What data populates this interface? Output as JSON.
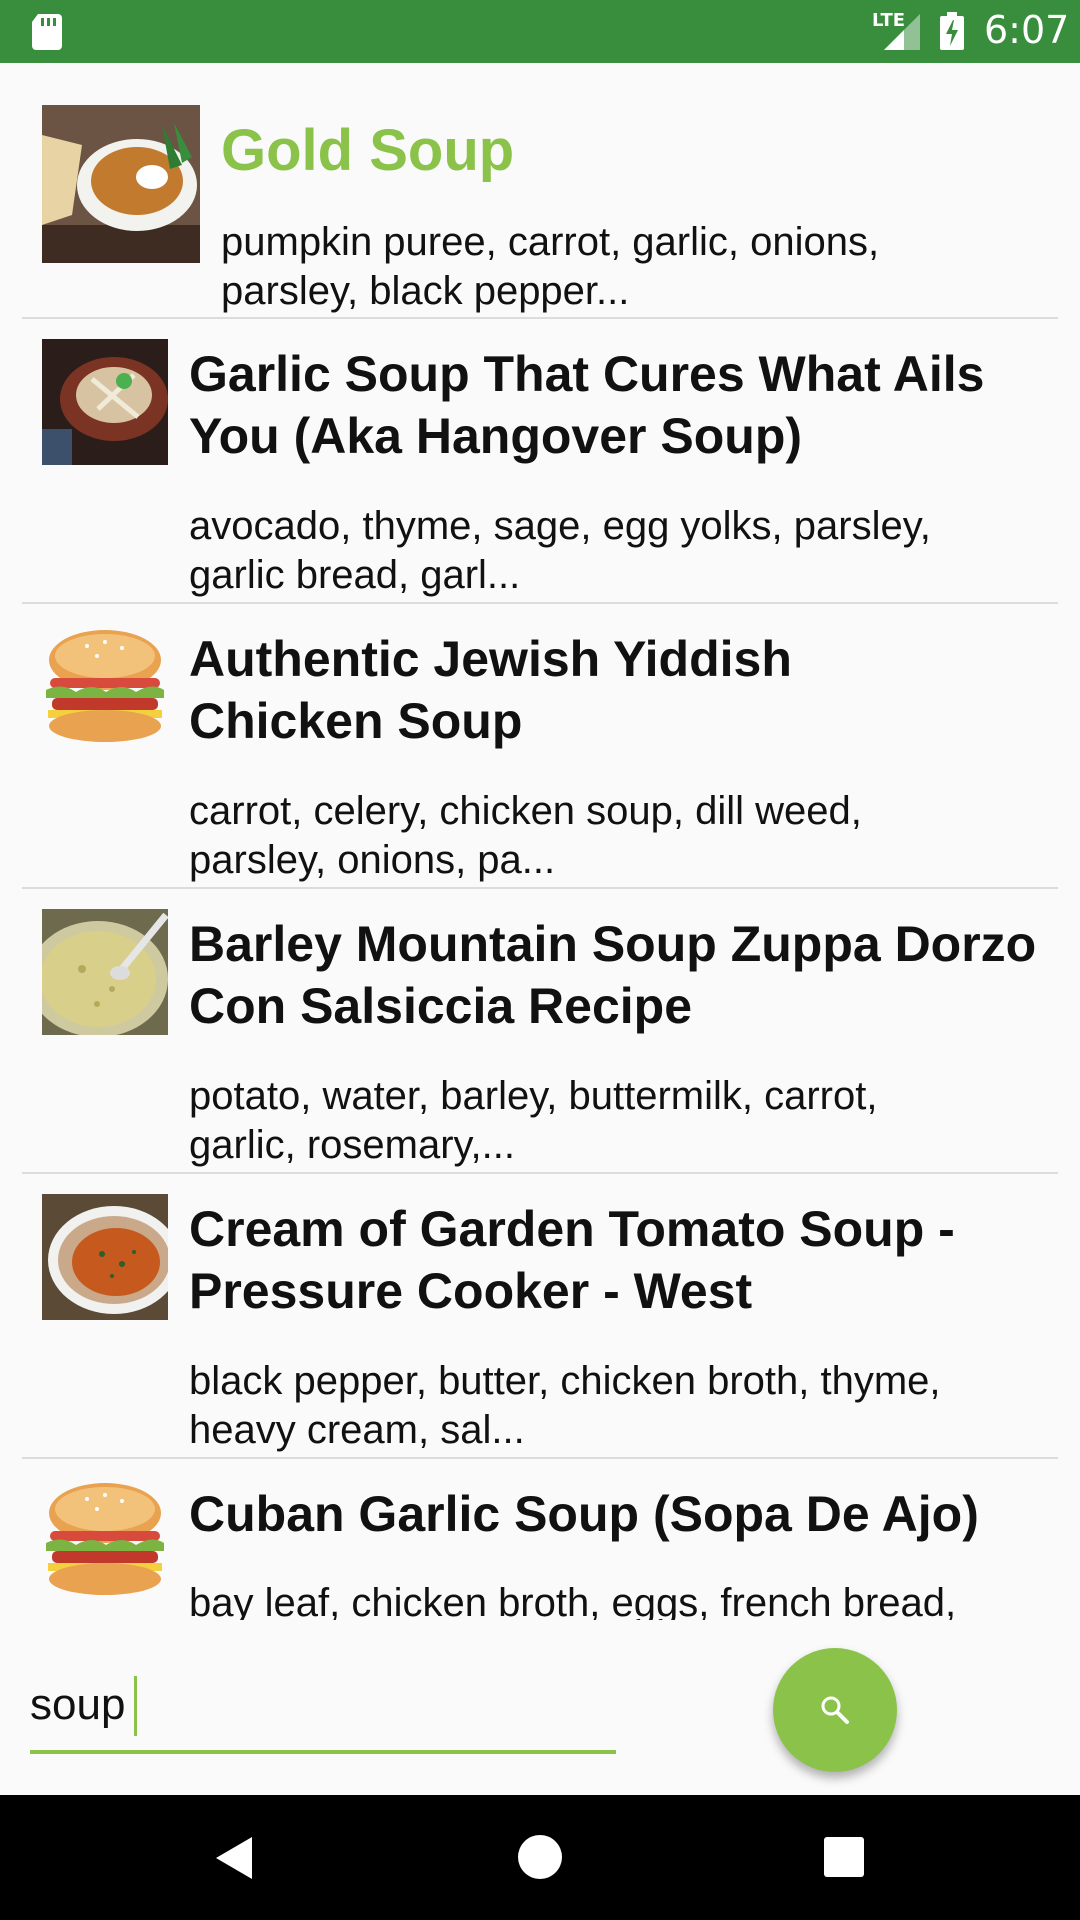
{
  "status_bar": {
    "network": "LTE",
    "time": "6:07"
  },
  "recipes": [
    {
      "title": "Gold Soup",
      "ingredients_line1": "pumpkin puree, carrot, garlic, onions,",
      "ingredients_line2": "parsley, black pepper...",
      "thumbnail": "soup-bowl-image"
    },
    {
      "title_line1": "Garlic Soup That Cures What Ails",
      "title_line2": "You (Aka Hangover Soup)",
      "ingredients_line1": "avocado, thyme, sage, egg yolks, parsley,",
      "ingredients_line2": "garlic bread, garl...",
      "thumbnail": "soup-bowl-image"
    },
    {
      "title_line1": "Authentic Jewish Yiddish",
      "title_line2": "Chicken Soup",
      "ingredients_line1": "carrot, celery, chicken soup, dill weed,",
      "ingredients_line2": "parsley, onions, pa...",
      "thumbnail": "burger-icon"
    },
    {
      "title_line1": "Barley Mountain Soup Zuppa Dorzo",
      "title_line2": "Con Salsiccia Recipe",
      "ingredients_line1": "potato, water, barley, buttermilk, carrot,",
      "ingredients_line2": "garlic, rosemary,...",
      "thumbnail": "soup-bowl-image"
    },
    {
      "title_line1": "Cream of Garden Tomato Soup -",
      "title_line2": "Pressure Cooker - West",
      "ingredients_line1": "black pepper, butter, chicken broth, thyme,",
      "ingredients_line2": "heavy cream, sal...",
      "thumbnail": "soup-bowl-image"
    },
    {
      "title": "Cuban Garlic Soup (Sopa De Ajo)",
      "ingredients_line1": "bay leaf, chicken broth, eggs, french bread,",
      "thumbnail": "burger-icon"
    }
  ],
  "search": {
    "value": "soup",
    "button_icon": "search-icon"
  },
  "colors": {
    "status_bar": "#388e3c",
    "accent": "#8bc34a"
  }
}
